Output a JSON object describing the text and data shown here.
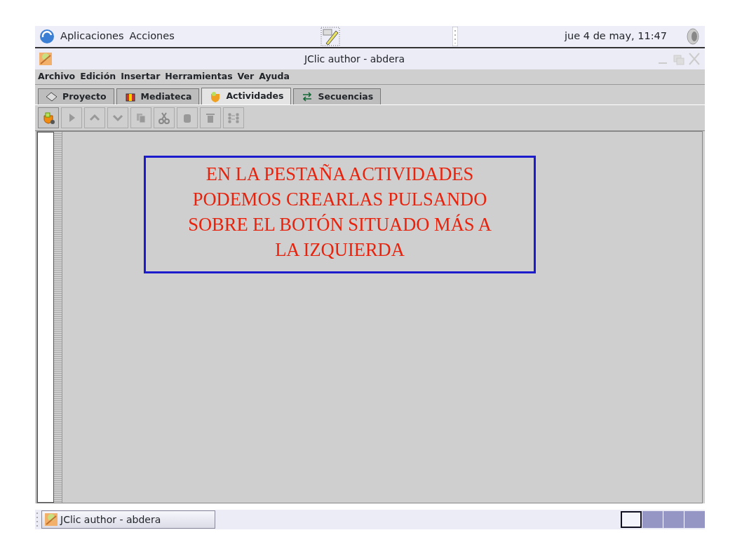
{
  "top_panel": {
    "menus": [
      "Aplicaciones",
      "Acciones"
    ],
    "clock": "jue  4 de may, 11:47"
  },
  "window": {
    "title": "JClic author - abdera"
  },
  "menu_bar": [
    "Archivo",
    "Edición",
    "Insertar",
    "Herramientas",
    "Ver",
    "Ayuda"
  ],
  "tabs": [
    {
      "label": "Proyecto",
      "kind": "project",
      "selected": false
    },
    {
      "label": "Mediateca",
      "kind": "media",
      "selected": false
    },
    {
      "label": "Actividades",
      "kind": "activities",
      "selected": true
    },
    {
      "label": "Secuencias",
      "kind": "sequences",
      "selected": false
    }
  ],
  "toolbar": [
    {
      "kind": "new",
      "disabled": false
    },
    {
      "kind": "play",
      "disabled": true
    },
    {
      "kind": "up",
      "disabled": true
    },
    {
      "kind": "down",
      "disabled": true
    },
    {
      "kind": "copy",
      "disabled": true
    },
    {
      "kind": "cut",
      "disabled": true
    },
    {
      "kind": "paste",
      "disabled": true
    },
    {
      "kind": "delete",
      "disabled": true
    },
    {
      "kind": "sort",
      "disabled": true
    }
  ],
  "annotation": "EN LA PESTAÑA ACTIVIDADES PODEMOS CREARLAS PULSANDO SOBRE EL BOTÓN SITUADO MÁS A LA IZQUIERDA",
  "taskbar": {
    "task": "JClic author - abdera",
    "workspaces": [
      {
        "selected": true
      },
      {
        "selected": false
      },
      {
        "selected": false
      },
      {
        "selected": false
      }
    ]
  }
}
